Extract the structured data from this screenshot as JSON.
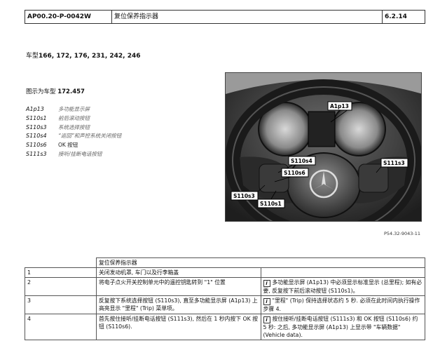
{
  "header": {
    "doc_id": "AP00.20-P-0042W",
    "title": "复位保养指示器",
    "section": "6.2.14"
  },
  "models": {
    "prefix": "车型",
    "list": "166, 172, 176, 231, 242, 246"
  },
  "figure": {
    "caption_prefix": "图示为车型",
    "caption_model": "172.457",
    "ref": "P54.32-9043-11",
    "labels": {
      "a1p13": "A1p13",
      "s110s4": "S110s4",
      "s110s6": "S110s6",
      "s110s3": "S110s3",
      "s110s1": "S110s1",
      "s111s3": "S111s3"
    }
  },
  "legend": [
    {
      "code": "A1p13",
      "desc": "多功能显示屏"
    },
    {
      "code": "S110s1",
      "desc": "前后滚动按钮"
    },
    {
      "code": "S110s3",
      "desc": "系统选择按钮"
    },
    {
      "code": "S110s4",
      "desc": "“返回”和声控系统关闭按钮"
    },
    {
      "code": "S110s6",
      "desc": "OK 按钮"
    },
    {
      "code": "S111s3",
      "desc": "接听/挂断电话按钮"
    }
  ],
  "table": {
    "heading": "复位保养指示器",
    "rows": [
      {
        "num": "1",
        "action": "关闭发动机罩, 车门以及行李箱盖",
        "note": ""
      },
      {
        "num": "2",
        "action": "将电子点火开关控制单元中的遥控钥匙转到 \"1\" 位置",
        "note": "多功能显示屏 (A1p13) 中必须显示标准显示 (总里程); 如有必要, 反复按下前后滚动按钮 (S110s1)。"
      },
      {
        "num": "3",
        "action": "反复按下系统选择按钮 (S110s3), 直至多功能显示屏 (A1p13) 上高亮显示 \"里程\" (Trip) 菜单项。",
        "note": "\"里程\" (Trip) 保持选择状态约 5 秒. 必须在此时间内执行操作步骤 4."
      },
      {
        "num": "4",
        "action": "首先按住接听/挂断电话按钮 (S111s3), 然后在 1 秒内按下 OK 按钮 (S110s6).",
        "note": "按住接听/挂断电话按钮 (S111s3) 和 OK 按钮 (S110s6) 约 5 秒: 之后, 多功能显示屏 (A1p13) 上显示带 \"车辆数据\" (Vehicle data)."
      }
    ]
  }
}
